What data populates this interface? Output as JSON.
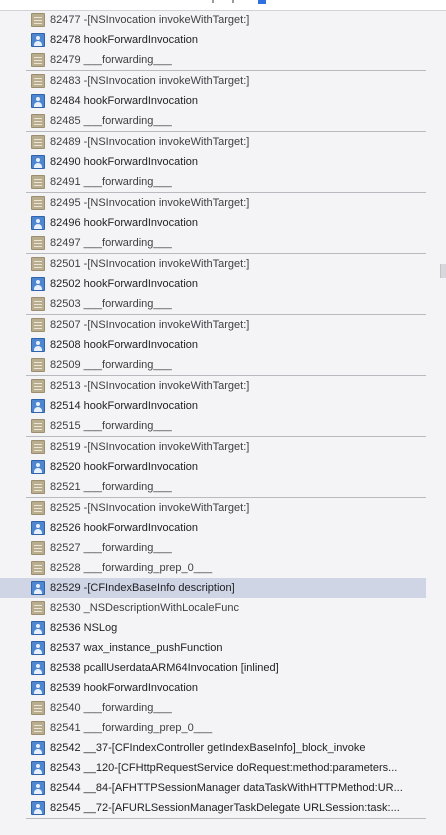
{
  "frames": [
    {
      "num": "82477",
      "label": "-[NSInvocation invokeWithTarget:]",
      "kind": "sys",
      "group_end": false
    },
    {
      "num": "82478",
      "label": "hookForwardInvocation",
      "kind": "usr",
      "group_end": false
    },
    {
      "num": "82479",
      "label": "___forwarding___",
      "kind": "sys",
      "group_end": true
    },
    {
      "num": "82483",
      "label": "-[NSInvocation invokeWithTarget:]",
      "kind": "sys",
      "group_end": false
    },
    {
      "num": "82484",
      "label": "hookForwardInvocation",
      "kind": "usr",
      "group_end": false
    },
    {
      "num": "82485",
      "label": "___forwarding___",
      "kind": "sys",
      "group_end": true
    },
    {
      "num": "82489",
      "label": "-[NSInvocation invokeWithTarget:]",
      "kind": "sys",
      "group_end": false
    },
    {
      "num": "82490",
      "label": "hookForwardInvocation",
      "kind": "usr",
      "group_end": false
    },
    {
      "num": "82491",
      "label": "___forwarding___",
      "kind": "sys",
      "group_end": true
    },
    {
      "num": "82495",
      "label": "-[NSInvocation invokeWithTarget:]",
      "kind": "sys",
      "group_end": false
    },
    {
      "num": "82496",
      "label": "hookForwardInvocation",
      "kind": "usr",
      "group_end": false
    },
    {
      "num": "82497",
      "label": "___forwarding___",
      "kind": "sys",
      "group_end": true
    },
    {
      "num": "82501",
      "label": "-[NSInvocation invokeWithTarget:]",
      "kind": "sys",
      "group_end": false
    },
    {
      "num": "82502",
      "label": "hookForwardInvocation",
      "kind": "usr",
      "group_end": false
    },
    {
      "num": "82503",
      "label": "___forwarding___",
      "kind": "sys",
      "group_end": true
    },
    {
      "num": "82507",
      "label": "-[NSInvocation invokeWithTarget:]",
      "kind": "sys",
      "group_end": false
    },
    {
      "num": "82508",
      "label": "hookForwardInvocation",
      "kind": "usr",
      "group_end": false
    },
    {
      "num": "82509",
      "label": "___forwarding___",
      "kind": "sys",
      "group_end": true
    },
    {
      "num": "82513",
      "label": "-[NSInvocation invokeWithTarget:]",
      "kind": "sys",
      "group_end": false
    },
    {
      "num": "82514",
      "label": "hookForwardInvocation",
      "kind": "usr",
      "group_end": false
    },
    {
      "num": "82515",
      "label": "___forwarding___",
      "kind": "sys",
      "group_end": true
    },
    {
      "num": "82519",
      "label": "-[NSInvocation invokeWithTarget:]",
      "kind": "sys",
      "group_end": false
    },
    {
      "num": "82520",
      "label": "hookForwardInvocation",
      "kind": "usr",
      "group_end": false
    },
    {
      "num": "82521",
      "label": "___forwarding___",
      "kind": "sys",
      "group_end": true
    },
    {
      "num": "82525",
      "label": "-[NSInvocation invokeWithTarget:]",
      "kind": "sys",
      "group_end": false
    },
    {
      "num": "82526",
      "label": "hookForwardInvocation",
      "kind": "usr",
      "group_end": false
    },
    {
      "num": "82527",
      "label": "___forwarding___",
      "kind": "sys",
      "group_end": false
    },
    {
      "num": "82528",
      "label": "___forwarding_prep_0___",
      "kind": "sys",
      "group_end": false
    },
    {
      "num": "82529",
      "label": "-[CFIndexBaseInfo description]",
      "kind": "usr",
      "group_end": false,
      "selected": true
    },
    {
      "num": "82530",
      "label": "_NSDescriptionWithLocaleFunc",
      "kind": "sys",
      "group_end": false
    },
    {
      "num": "82536",
      "label": "NSLog",
      "kind": "usr",
      "group_end": false
    },
    {
      "num": "82537",
      "label": "wax_instance_pushFunction",
      "kind": "usr",
      "group_end": false
    },
    {
      "num": "82538",
      "label": "pcallUserdataARM64Invocation [inlined]",
      "kind": "usr",
      "group_end": false
    },
    {
      "num": "82539",
      "label": "hookForwardInvocation",
      "kind": "usr",
      "group_end": false
    },
    {
      "num": "82540",
      "label": "___forwarding___",
      "kind": "sys",
      "group_end": false
    },
    {
      "num": "82541",
      "label": "___forwarding_prep_0___",
      "kind": "sys",
      "group_end": false
    },
    {
      "num": "82542",
      "label": "__37-[CFIndexController getIndexBaseInfo]_block_invoke",
      "kind": "usr",
      "group_end": false
    },
    {
      "num": "82543",
      "label": "__120-[CFHttpRequestService doRequest:method:parameters...",
      "kind": "usr",
      "group_end": false
    },
    {
      "num": "82544",
      "label": "__84-[AFHTTPSessionManager dataTaskWithHTTPMethod:UR...",
      "kind": "usr",
      "group_end": false
    },
    {
      "num": "82545",
      "label": "__72-[AFURLSessionManagerTaskDelegate URLSession:task:...",
      "kind": "usr",
      "group_end": false
    }
  ],
  "colors": {
    "selection": "#cfd5e4",
    "user_icon": "#4e86cf",
    "system_icon": "#b9ad90"
  }
}
